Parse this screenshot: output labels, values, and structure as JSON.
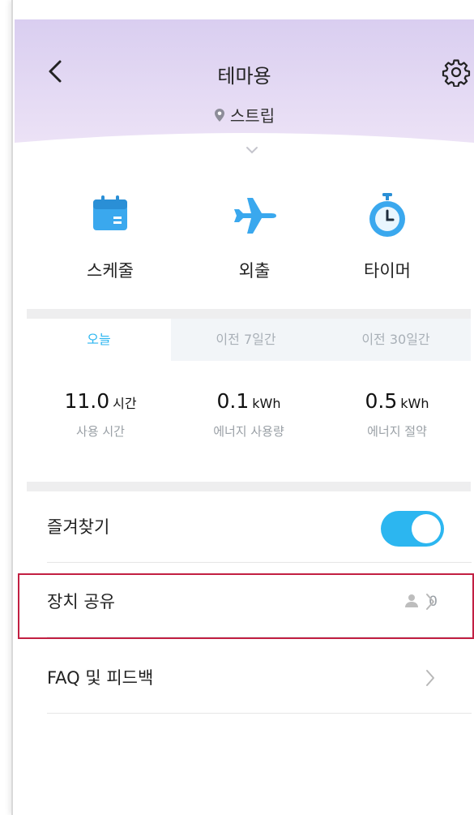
{
  "header": {
    "title": "테마용",
    "location": "스트립",
    "gradient_colors": [
      "#d8cdf0",
      "#eadff5"
    ]
  },
  "actions": [
    {
      "label": "스케줄",
      "icon": "calendar-icon"
    },
    {
      "label": "외출",
      "icon": "airplane-icon"
    },
    {
      "label": "타이머",
      "icon": "stopwatch-icon"
    }
  ],
  "tabs": [
    {
      "label": "오늘",
      "active": true
    },
    {
      "label": "이전 7일간",
      "active": false
    },
    {
      "label": "이전 30일간",
      "active": false
    }
  ],
  "stats": [
    {
      "value": "11.0",
      "unit": "시간",
      "caption": "사용 시간"
    },
    {
      "value": "0.1",
      "unit": "kWh",
      "caption": "에너지 사용량"
    },
    {
      "value": "0.5",
      "unit": "kWh",
      "caption": "에너지 절약"
    }
  ],
  "rows": {
    "favorites": {
      "label": "즐겨찾기",
      "toggle_on": true
    },
    "device_share": {
      "label": "장치 공유",
      "count": "0"
    },
    "faq": {
      "label": "FAQ 및 피드백"
    }
  },
  "colors": {
    "accent": "#2cb6f0",
    "highlight": "#c21f42"
  }
}
